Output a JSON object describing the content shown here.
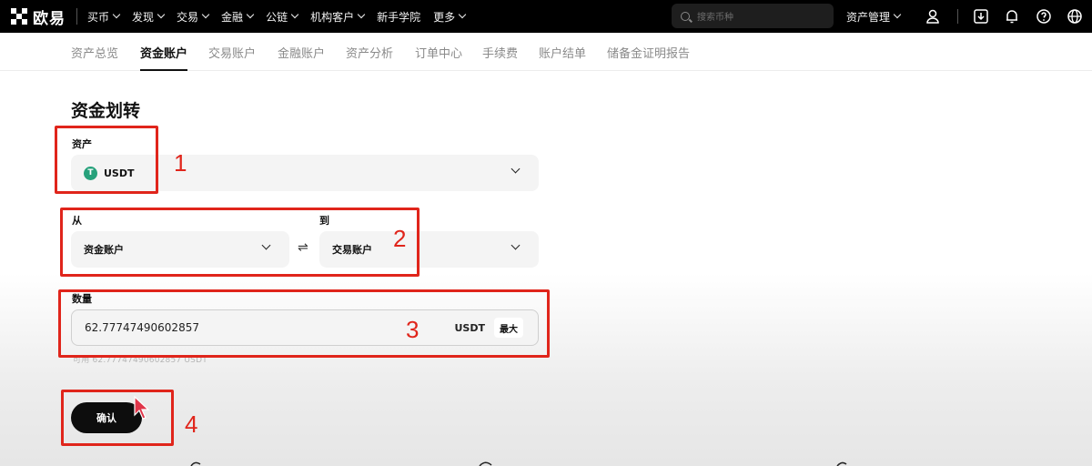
{
  "header": {
    "brand": "欧易",
    "nav": [
      {
        "label": "买币",
        "dropdown": true
      },
      {
        "label": "发现",
        "dropdown": true
      },
      {
        "label": "交易",
        "dropdown": true
      },
      {
        "label": "金融",
        "dropdown": true
      },
      {
        "label": "公链",
        "dropdown": true
      },
      {
        "label": "机构客户",
        "dropdown": true
      },
      {
        "label": "新手学院",
        "dropdown": false
      },
      {
        "label": "更多",
        "dropdown": true
      }
    ],
    "search_placeholder": "搜索币种",
    "asset_mgmt": "资产管理",
    "icons": [
      "user-icon",
      "download-icon",
      "bell-icon",
      "help-icon",
      "globe-icon"
    ]
  },
  "subnav": {
    "tabs": [
      "资产总览",
      "资金账户",
      "交易账户",
      "金融账户",
      "资产分析",
      "订单中心",
      "手续费",
      "账户结单",
      "储备金证明报告"
    ],
    "active": "资金账户"
  },
  "form": {
    "title": "资金划转",
    "asset_label": "资产",
    "asset_value": "USDT",
    "asset_icon_letter": "T",
    "from_label": "从",
    "from_value": "资金账户",
    "to_label": "到",
    "to_value": "交易账户",
    "amount_label": "数量",
    "amount_value": "62.77747490602857",
    "amount_unit": "USDT",
    "max_label": "最大",
    "available_text": "可用 62.77747490602857 USDT",
    "confirm_label": "确认"
  },
  "annotations": [
    "1",
    "2",
    "3",
    "4"
  ],
  "colors": {
    "annotation": "#e0251b",
    "usdt": "#26a17b",
    "header_bg": "#000000"
  }
}
